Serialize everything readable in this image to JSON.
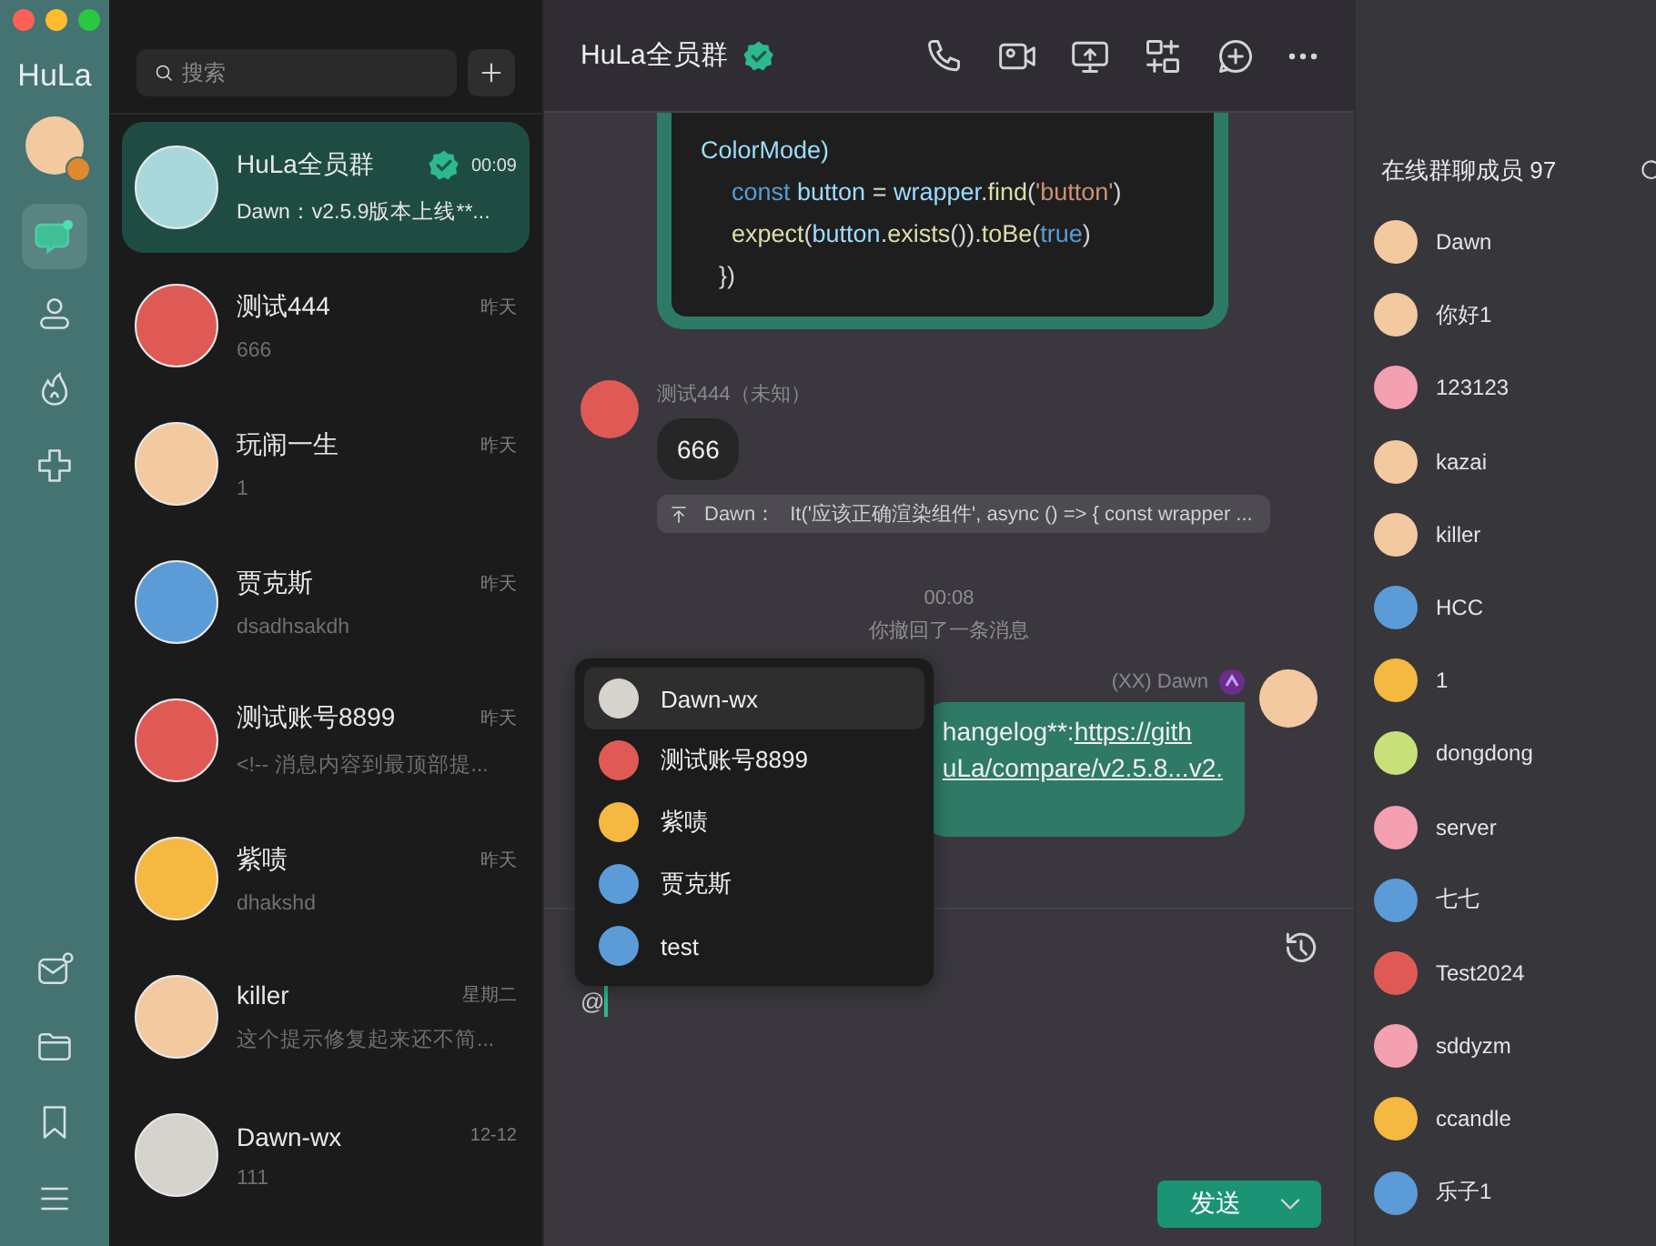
{
  "window": {
    "app_name": "HuLa"
  },
  "rail": {
    "top_items": [
      {
        "kind": "chat",
        "selected": true
      },
      {
        "kind": "contacts",
        "selected": false
      },
      {
        "kind": "fire",
        "selected": false
      },
      {
        "kind": "plugins",
        "selected": false
      }
    ],
    "bottom_items": [
      {
        "kind": "mail"
      },
      {
        "kind": "folder"
      },
      {
        "kind": "bookmark"
      },
      {
        "kind": "menu"
      }
    ]
  },
  "search": {
    "placeholder": "搜索"
  },
  "chats": [
    {
      "name": "HuLa全员群",
      "time": "00:09",
      "preview": "Dawn：v2.5.9版本上线**...",
      "selected": true,
      "verified": true,
      "color": "#a8d8dc"
    },
    {
      "name": "测试444",
      "time": "昨天",
      "preview": "666",
      "selected": false,
      "verified": false,
      "color": "#e05a55"
    },
    {
      "name": "玩闹一生",
      "time": "昨天",
      "preview": "1",
      "selected": false,
      "verified": false,
      "color": "#f3c9a0"
    },
    {
      "name": "贾克斯",
      "time": "昨天",
      "preview": "dsadhsakdh",
      "selected": false,
      "verified": false,
      "color": "#5b9bd8"
    },
    {
      "name": "测试账号8899",
      "time": "昨天",
      "preview": "<!-- 消息内容到最顶部提...",
      "selected": false,
      "verified": false,
      "color": "#e05a55"
    },
    {
      "name": "紫啧",
      "time": "昨天",
      "preview": "dhakshd",
      "selected": false,
      "verified": false,
      "color": "#f5b840"
    },
    {
      "name": "killer",
      "time": "星期二",
      "preview": "这个提示修复起来还不简...",
      "selected": false,
      "verified": false,
      "color": "#f3c9a0"
    },
    {
      "name": "Dawn-wx",
      "time": "12-12",
      "preview": "111",
      "selected": false,
      "verified": false,
      "color": "#d6d2cc"
    }
  ],
  "header": {
    "title": "HuLa全员群",
    "verified": true
  },
  "messages": [
    {
      "kind": "code",
      "lines": [
        {
          "kind": "cont",
          "tokens": [
            {
              "kind": "ident",
              "text": "ColorMode)"
            }
          ]
        },
        {
          "kind": "body",
          "tokens": [
            {
              "kind": "keyword",
              "text": "const"
            },
            {
              "kind": "ident",
              "text": " button"
            },
            {
              "kind": "plain",
              "text": " = "
            },
            {
              "kind": "ident",
              "text": "wrapper"
            },
            {
              "kind": "plain",
              "text": "."
            },
            {
              "kind": "func",
              "text": "find"
            },
            {
              "kind": "plain",
              "text": "("
            },
            {
              "kind": "string",
              "text": "'button'"
            },
            {
              "kind": "plain",
              "text": ")"
            }
          ]
        },
        {
          "kind": "body",
          "tokens": [
            {
              "kind": "func",
              "text": "expect"
            },
            {
              "kind": "plain",
              "text": "("
            },
            {
              "kind": "ident",
              "text": "button"
            },
            {
              "kind": "plain",
              "text": "."
            },
            {
              "kind": "func",
              "text": "exists"
            },
            {
              "kind": "plain",
              "text": "())."
            },
            {
              "kind": "func",
              "text": "toBe"
            },
            {
              "kind": "plain",
              "text": "("
            },
            {
              "kind": "keyword",
              "text": "true"
            },
            {
              "kind": "plain",
              "text": ")"
            }
          ]
        },
        {
          "kind": "close",
          "tokens": [
            {
              "kind": "plain",
              "text": "})"
            }
          ]
        }
      ]
    },
    {
      "kind": "text",
      "sender": "测试444（未知）",
      "body": "666",
      "color": "#e05a55",
      "reply": {
        "author": "Dawn：",
        "text": "It('应该正确渲染组件', async () => { const wrapper ..."
      }
    },
    {
      "kind": "time",
      "text": "00:08"
    },
    {
      "kind": "system",
      "text": "你撤回了一条消息"
    },
    {
      "kind": "self",
      "sender": "(XX) Dawn",
      "color": "#f3c9a0",
      "lines": [
        {
          "prefix": "hangelog**: ",
          "link": "https://gith"
        },
        {
          "link": "uLa/compare/v2.5.8...v2."
        }
      ]
    }
  ],
  "mention_menu": {
    "items": [
      {
        "name": "Dawn-wx",
        "selected": true,
        "color": "#d6d2cc"
      },
      {
        "name": "测试账号8899",
        "selected": false,
        "color": "#e05a55"
      },
      {
        "name": "紫啧",
        "selected": false,
        "color": "#f5b840"
      },
      {
        "name": "贾克斯",
        "selected": false,
        "color": "#5b9bd8"
      },
      {
        "name": "test",
        "selected": false,
        "color": "#5b9bd8"
      }
    ]
  },
  "composer": {
    "value": "@",
    "send_label": "发送"
  },
  "members": {
    "title": "在线群聊成员 97",
    "items": [
      {
        "name": "Dawn",
        "color": "#f3c9a0"
      },
      {
        "name": "你好1",
        "color": "#f3c9a0"
      },
      {
        "name": "123123",
        "color": "#f4a0b0"
      },
      {
        "name": "kazai",
        "color": "#f3c9a0"
      },
      {
        "name": "killer",
        "color": "#f3c9a0"
      },
      {
        "name": "HCC",
        "color": "#5b9bd8"
      },
      {
        "name": "1",
        "color": "#f5b840"
      },
      {
        "name": "dongdong",
        "color": "#c8e07a"
      },
      {
        "name": "server",
        "color": "#f4a0b0"
      },
      {
        "name": "七七",
        "color": "#5b9bd8"
      },
      {
        "name": "Test2024",
        "color": "#e05a55"
      },
      {
        "name": "sddyzm",
        "color": "#f4a0b0"
      },
      {
        "name": "ccandle",
        "color": "#f5b840"
      },
      {
        "name": "乐子1",
        "color": "#5b9bd8"
      }
    ]
  }
}
